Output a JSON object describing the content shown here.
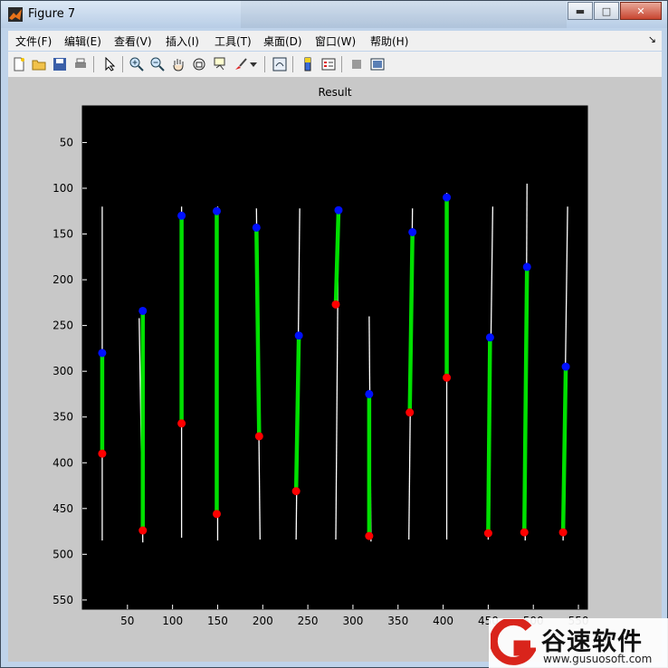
{
  "window": {
    "title": "Figure 7"
  },
  "title_buttons": {
    "minimize": "▬",
    "maximize": "□",
    "close": "✕"
  },
  "menu": [
    "文件(F)",
    "编辑(E)",
    "查看(V)",
    "插入(I)",
    "工具(T)",
    "桌面(D)",
    "窗口(W)",
    "帮助(H)"
  ],
  "menu_arrow": "↘",
  "toolbar": [
    "new-figure-icon",
    "open-file-icon",
    "save-icon",
    "print-icon",
    "pointer-icon",
    "zoom-in-icon",
    "zoom-out-icon",
    "pan-icon",
    "rotate-3d-icon",
    "data-cursor-icon",
    "brush-icon",
    "link-plot-icon",
    "colorbar-icon",
    "legend-icon",
    "hide-plot-tools-icon",
    "show-plot-tools-icon"
  ],
  "watermark": {
    "brand": "谷速软件",
    "url": "www.gusuosoft.com"
  },
  "chart_data": {
    "type": "image",
    "title": "Result",
    "xlim": [
      0,
      560
    ],
    "ylim": [
      560,
      10
    ],
    "xticks": [
      "50",
      "100",
      "150",
      "200",
      "250",
      "300",
      "350",
      "400",
      "450",
      "500",
      "550"
    ],
    "yticks": [
      "50",
      "100",
      "150",
      "200",
      "250",
      "300",
      "350",
      "400",
      "450",
      "500",
      "550"
    ],
    "background": "#000000",
    "colors": {
      "white_lines": "#ffffff",
      "segments": "#00e000",
      "top_points": "#0010ff",
      "bottom_points": "#ff0000"
    },
    "white_lines": [
      {
        "x_top": 22,
        "y_top": 120,
        "x_bottom": 22,
        "y_bottom": 485
      },
      {
        "x_top": 63,
        "y_top": 242,
        "x_bottom": 67,
        "y_bottom": 487
      },
      {
        "x_top": 110,
        "y_top": 120,
        "x_bottom": 110,
        "y_bottom": 482
      },
      {
        "x_top": 150,
        "y_top": 120,
        "x_bottom": 150,
        "y_bottom": 485
      },
      {
        "x_top": 193,
        "y_top": 122,
        "x_bottom": 197,
        "y_bottom": 484
      },
      {
        "x_top": 241,
        "y_top": 122,
        "x_bottom": 237,
        "y_bottom": 484
      },
      {
        "x_top": 284,
        "y_top": 123,
        "x_bottom": 281,
        "y_bottom": 484
      },
      {
        "x_top": 318,
        "y_top": 240,
        "x_bottom": 320,
        "y_bottom": 486
      },
      {
        "x_top": 366,
        "y_top": 122,
        "x_bottom": 362,
        "y_bottom": 484
      },
      {
        "x_top": 404,
        "y_top": 105,
        "x_bottom": 404,
        "y_bottom": 484
      },
      {
        "x_top": 455,
        "y_top": 120,
        "x_bottom": 450,
        "y_bottom": 484
      },
      {
        "x_top": 493,
        "y_top": 95,
        "x_bottom": 491,
        "y_bottom": 485
      },
      {
        "x_top": 538,
        "y_top": 120,
        "x_bottom": 533,
        "y_bottom": 485
      }
    ],
    "segments": [
      {
        "x1": 22,
        "y1": 280,
        "x2": 22,
        "y2": 390
      },
      {
        "x1": 67,
        "y1": 234,
        "x2": 67,
        "y2": 474
      },
      {
        "x1": 110,
        "y1": 130,
        "x2": 110,
        "y2": 357
      },
      {
        "x1": 149,
        "y1": 125,
        "x2": 149,
        "y2": 456
      },
      {
        "x1": 193,
        "y1": 143,
        "x2": 196,
        "y2": 371
      },
      {
        "x1": 240,
        "y1": 261,
        "x2": 237,
        "y2": 431
      },
      {
        "x1": 284,
        "y1": 124,
        "x2": 281,
        "y2": 227
      },
      {
        "x1": 318,
        "y1": 325,
        "x2": 318,
        "y2": 480
      },
      {
        "x1": 366,
        "y1": 148,
        "x2": 363,
        "y2": 345
      },
      {
        "x1": 404,
        "y1": 110,
        "x2": 404,
        "y2": 307
      },
      {
        "x1": 452,
        "y1": 263,
        "x2": 450,
        "y2": 477
      },
      {
        "x1": 493,
        "y1": 186,
        "x2": 490,
        "y2": 476
      },
      {
        "x1": 536,
        "y1": 295,
        "x2": 533,
        "y2": 476
      }
    ]
  }
}
